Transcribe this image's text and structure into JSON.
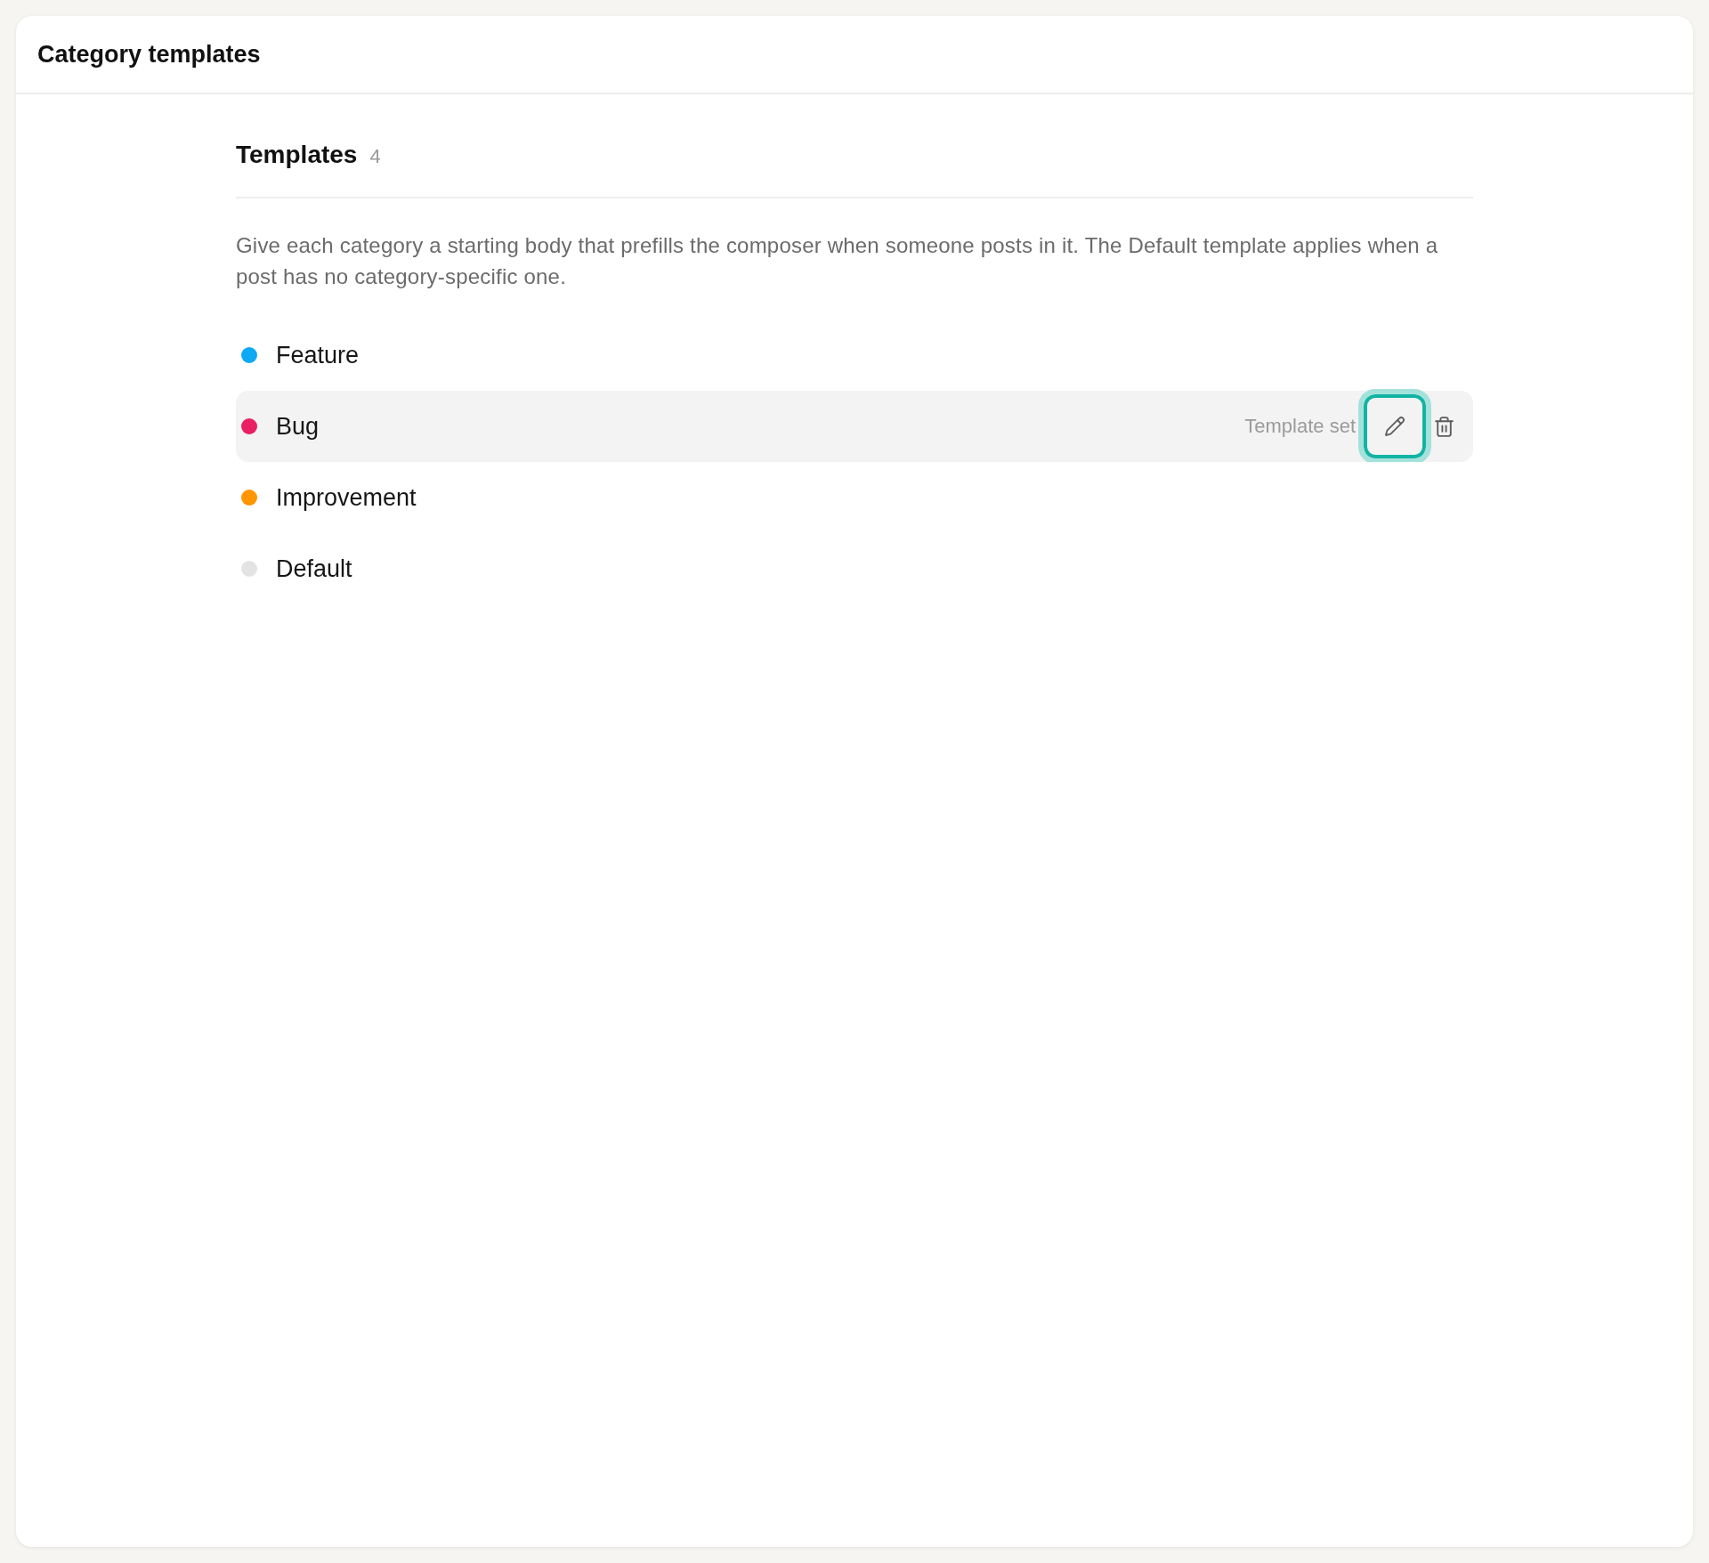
{
  "panel": {
    "title": "Category templates"
  },
  "section": {
    "title": "Templates",
    "count": "4",
    "description": "Give each category a starting body that prefills the composer when someone posts in it. The Default template applies when a post has no category-specific one."
  },
  "categories": [
    {
      "name": "Feature",
      "color": "#0ea8f5",
      "highlighted": false
    },
    {
      "name": "Bug",
      "color": "#e91e63",
      "highlighted": true,
      "status": "Template set",
      "actions": [
        {
          "kind": "edit",
          "focused": true
        },
        {
          "kind": "delete",
          "focused": false
        }
      ]
    },
    {
      "name": "Improvement",
      "color": "#ff9500",
      "highlighted": false
    },
    {
      "name": "Default",
      "color": "#e3e3e3",
      "highlighted": false
    }
  ]
}
